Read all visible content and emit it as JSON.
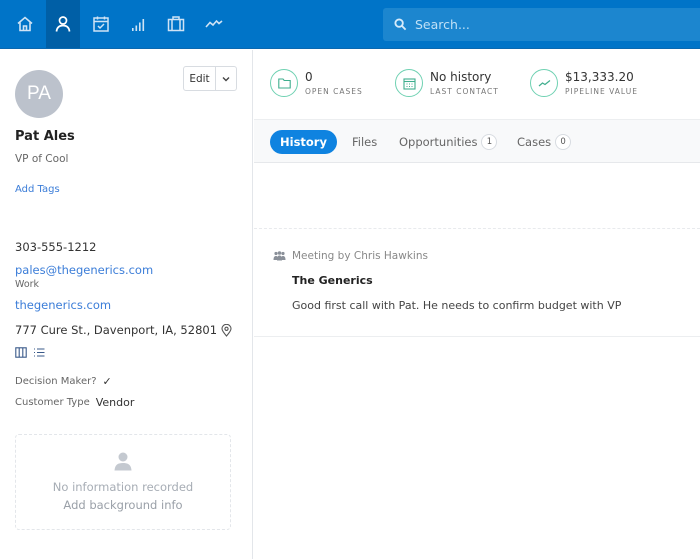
{
  "nav": {
    "items": [
      {
        "name": "home",
        "icon": "home-icon",
        "active": false
      },
      {
        "name": "contacts",
        "icon": "person-icon",
        "active": true
      },
      {
        "name": "calendar",
        "icon": "calendar-icon",
        "active": false
      },
      {
        "name": "reports",
        "icon": "bar-chart-icon",
        "active": false
      },
      {
        "name": "cases",
        "icon": "briefcase-icon",
        "active": false
      },
      {
        "name": "activity",
        "icon": "trend-line-icon",
        "active": false
      }
    ],
    "search_placeholder": "Search..."
  },
  "contact": {
    "initials": "PA",
    "name": "Pat Ales",
    "title": "VP of Cool",
    "add_tags": "Add Tags",
    "edit_label": "Edit",
    "phone": "303-555-1212",
    "email": "pales@thegenerics.com",
    "email_type": "Work",
    "website": "thegenerics.com",
    "address": "777 Cure St., Davenport, IA, 52801",
    "decision_maker_label": "Decision Maker?",
    "decision_maker_value": "✓",
    "customer_type_label": "Customer Type",
    "customer_type_value": "Vendor",
    "background": {
      "line1": "No information recorded",
      "line2": "Add background info"
    }
  },
  "stats": [
    {
      "value": "0",
      "label": "OPEN CASES",
      "icon": "folder-icon"
    },
    {
      "value": "No history",
      "label": "LAST CONTACT",
      "icon": "calendar-icon"
    },
    {
      "value": "$13,333.20",
      "label": "PIPELINE VALUE",
      "icon": "trend-line-icon"
    }
  ],
  "tabs": [
    {
      "label": "History",
      "active": true
    },
    {
      "label": "Files",
      "active": false
    },
    {
      "label": "Opportunities",
      "count": "1",
      "active": false
    },
    {
      "label": "Cases",
      "count": "0",
      "active": false
    }
  ],
  "colors": {
    "topbar": "#0074c8",
    "accent": "#0f83e0",
    "link": "#3b7dd8",
    "stat_ring": "#6fd1b2"
  },
  "history": [
    {
      "type": "Meeting by Chris Hawkins",
      "title": "The Generics",
      "body": "Good first call with Pat. He needs to confirm budget with VP"
    }
  ]
}
